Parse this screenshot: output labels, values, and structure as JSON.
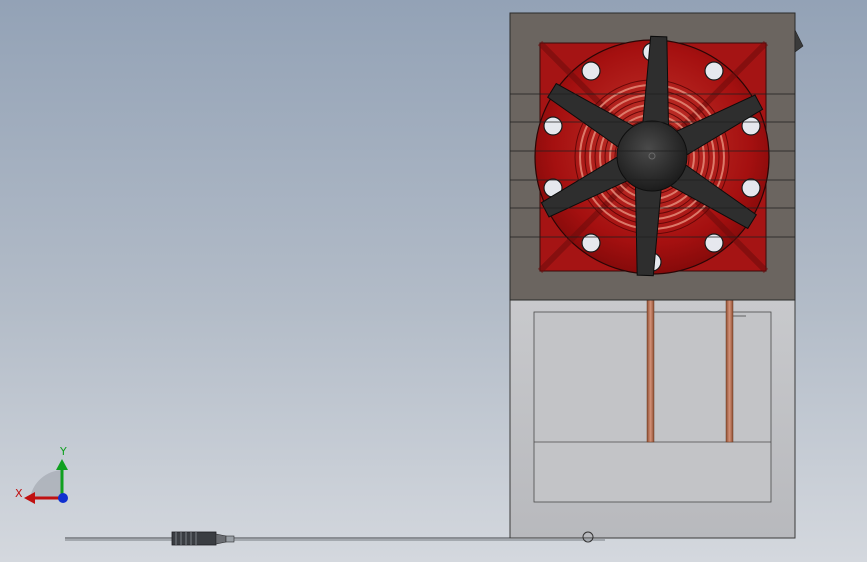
{
  "viewport": {
    "background_top": "#93a2b6",
    "background_bottom": "#d4d8de"
  },
  "model": {
    "housing_color": "#6b6560",
    "fan_guard_color": "#b01212",
    "blade_color": "#2e2e2e",
    "lower_box_color": "#c4c5c8",
    "pipe_color": "#b87353",
    "blade_count": 6
  },
  "triad": {
    "x_label": "X",
    "y_label": "Y",
    "x_color": "#c01010",
    "y_color": "#10a020",
    "z_color": "#1030d0"
  }
}
